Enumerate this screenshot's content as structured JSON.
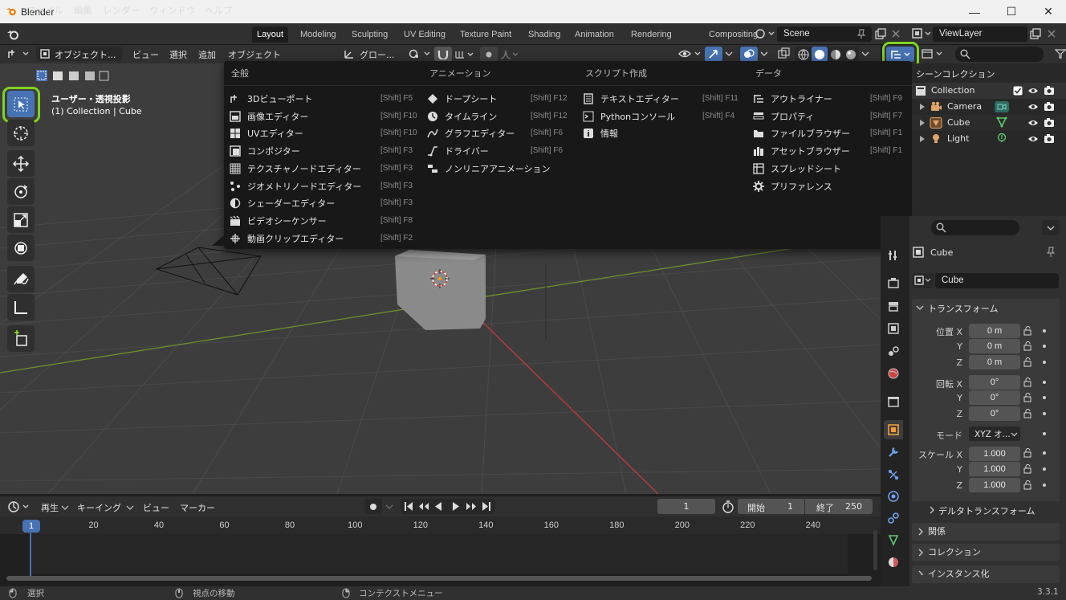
{
  "window": {
    "title": "Blender",
    "controls": [
      "minimize",
      "maximize",
      "close"
    ]
  },
  "menubar": {
    "items": [
      "ファイル",
      "編集",
      "レンダー",
      "ウィンドウ",
      "ヘルプ"
    ]
  },
  "workspaces": [
    "Layout",
    "Modeling",
    "Sculpting",
    "UV Editing",
    "Texture Paint",
    "Shading",
    "Animation",
    "Rendering",
    "Compositing"
  ],
  "scene": {
    "name": "Scene",
    "view_layer": "ViewLayer"
  },
  "viewport_header": {
    "mode": "オブジェクト...",
    "menus": [
      "ビュー",
      "選択",
      "追加",
      "オブジェクト"
    ],
    "transform_orientation": "グロー..."
  },
  "viewport": {
    "view_name": "ユーザー・透視投影",
    "collection_info": "(1) Collection | Cube"
  },
  "editor_type_menu": {
    "categories": [
      "全般",
      "アニメーション",
      "スクリプト作成",
      "データ"
    ],
    "general": [
      {
        "label": "3Dビューポート",
        "key": "[Shift] F5",
        "icon": "viewport-3d-icon"
      },
      {
        "label": "画像エディター",
        "key": "[Shift] F10",
        "icon": "image-editor-icon"
      },
      {
        "label": "UVエディター",
        "key": "[Shift] F10",
        "icon": "uv-editor-icon"
      },
      {
        "label": "コンポジター",
        "key": "[Shift] F3",
        "icon": "compositor-icon"
      },
      {
        "label": "テクスチャノードエディター",
        "key": "[Shift] F3",
        "icon": "texture-node-icon"
      },
      {
        "label": "ジオメトリノードエディター",
        "key": "[Shift] F3",
        "icon": "geometry-node-icon"
      },
      {
        "label": "シェーダーエディター",
        "key": "[Shift] F3",
        "icon": "shader-editor-icon"
      },
      {
        "label": "ビデオシーケンサー",
        "key": "[Shift] F8",
        "icon": "sequencer-icon"
      },
      {
        "label": "動画クリップエディター",
        "key": "[Shift] F2",
        "icon": "clip-editor-icon"
      }
    ],
    "animation": [
      {
        "label": "ドープシート",
        "key": "[Shift] F12",
        "icon": "dopesheet-icon"
      },
      {
        "label": "タイムライン",
        "key": "[Shift] F12",
        "icon": "timeline-icon"
      },
      {
        "label": "グラフエディター",
        "key": "[Shift] F6",
        "icon": "graph-editor-icon"
      },
      {
        "label": "ドライバー",
        "key": "[Shift] F6",
        "icon": "driver-icon"
      },
      {
        "label": "ノンリニアアニメーション",
        "key": "",
        "icon": "nla-icon"
      }
    ],
    "scripting": [
      {
        "label": "テキストエディター",
        "key": "[Shift] F11",
        "icon": "text-editor-icon"
      },
      {
        "label": "Pythonコンソール",
        "key": "[Shift] F4",
        "icon": "python-console-icon"
      },
      {
        "label": "情報",
        "key": "",
        "icon": "info-icon"
      }
    ],
    "data": [
      {
        "label": "アウトライナー",
        "key": "[Shift] F9",
        "icon": "outliner-icon"
      },
      {
        "label": "プロパティ",
        "key": "[Shift] F7",
        "icon": "properties-icon"
      },
      {
        "label": "ファイルブラウザー",
        "key": "[Shift] F1",
        "icon": "file-browser-icon"
      },
      {
        "label": "アセットブラウザー",
        "key": "[Shift] F1",
        "icon": "asset-browser-icon"
      },
      {
        "label": "スプレッドシート",
        "key": "",
        "icon": "spreadsheet-icon"
      },
      {
        "label": "プリファレンス",
        "key": "",
        "icon": "preferences-icon"
      }
    ]
  },
  "outliner": {
    "title": "シーンコレクション",
    "collection": "Collection",
    "items": [
      "Camera",
      "Cube",
      "Light"
    ]
  },
  "properties": {
    "object_name": "Cube",
    "data_name": "Cube",
    "transform_title": "トランスフォーム",
    "location_label": "位置 X",
    "location": [
      "0 m",
      "0 m",
      "0 m"
    ],
    "rotation_label": "回転 X",
    "rotation": [
      "0°",
      "0°",
      "0°"
    ],
    "mode_label": "モード",
    "mode_value": "XYZ オ...",
    "scale_label": "スケール X",
    "scale": [
      "1.000",
      "1.000",
      "1.000"
    ],
    "axis_y": "Y",
    "axis_z": "Z",
    "delta_transform": "デルタトランスフォーム",
    "sections": [
      "関係",
      "コレクション",
      "インスタンス化"
    ]
  },
  "timeline": {
    "menus": [
      "再生",
      "キーイング",
      "ビュー",
      "マーカー"
    ],
    "current_frame": "1",
    "start_label": "開始",
    "start": "1",
    "end_label": "終了",
    "end": "250",
    "ticks": [
      "20",
      "40",
      "60",
      "80",
      "100",
      "120",
      "140",
      "160",
      "180",
      "200",
      "220",
      "240"
    ],
    "playhead": "1"
  },
  "statusbar": {
    "select": "選択",
    "move": "視点の移動",
    "context": "コンテクストメニュー",
    "version": "3.3.1"
  },
  "colors": {
    "highlight": "#7ed321",
    "active_blue": "#4772b3",
    "playhead": "#4772b3"
  }
}
